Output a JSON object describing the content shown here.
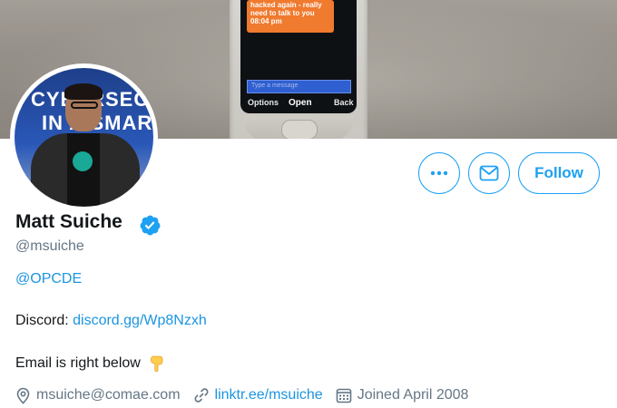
{
  "banner": {
    "phone": {
      "message_line1": "hacked again - really",
      "message_line2": "need to talk to you",
      "message_time": "08:04 pm",
      "input_placeholder": "Type a message",
      "softkey_left": "Options",
      "softkey_middle": "Open",
      "softkey_right": "Back"
    }
  },
  "avatar": {
    "text_line1": "CYBERSEC",
    "text_line2": "IN A SMART"
  },
  "actions": {
    "more_icon": "more-dots-icon",
    "message_icon": "envelope-icon",
    "follow_label": "Follow"
  },
  "profile": {
    "name": "Matt Suiche",
    "verified_icon": "verified-badge-icon",
    "handle": "@msuiche",
    "bio_mention": "@OPCDE",
    "discord_label": "Discord: ",
    "discord_link": "discord.gg/Wp8Nzxh",
    "email_note": "Email is right below",
    "email_emoji": "pointing-down-hand-icon",
    "location": "msuiche@comae.com",
    "website": "linktr.ee/msuiche",
    "joined": "Joined April 2008"
  },
  "colors": {
    "accent": "#1da1f2",
    "link": "#1b95e0",
    "muted": "#657786",
    "text": "#14171a"
  }
}
